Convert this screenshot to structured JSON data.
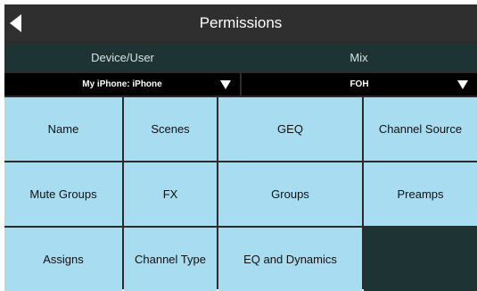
{
  "header": {
    "title": "Permissions"
  },
  "tabs": [
    {
      "label": "Device/User"
    },
    {
      "label": "Mix"
    }
  ],
  "dropdowns": {
    "device": {
      "value": "My iPhone: iPhone"
    },
    "mix": {
      "value": "FOH"
    }
  },
  "grid": {
    "items": [
      {
        "label": "Name"
      },
      {
        "label": "Scenes"
      },
      {
        "label": "GEQ"
      },
      {
        "label": "Channel Source"
      },
      {
        "label": "Mute Groups"
      },
      {
        "label": "FX"
      },
      {
        "label": "Groups"
      },
      {
        "label": "Preamps"
      },
      {
        "label": "Assigns"
      },
      {
        "label": "Channel Type"
      },
      {
        "label": "EQ and Dynamics"
      }
    ]
  },
  "colors": {
    "button": "#a8dcf0",
    "tab_bar": "#1e3434",
    "title_bar": "#2f2f2f"
  }
}
